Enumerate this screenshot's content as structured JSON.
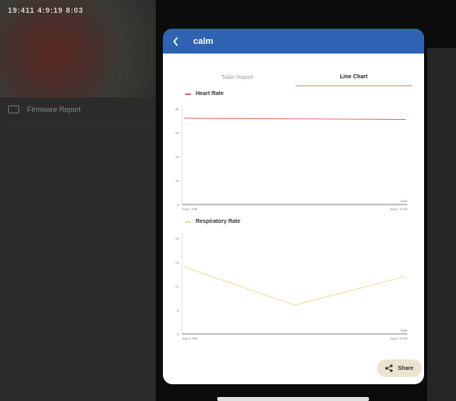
{
  "status_bar": {
    "text": "19:411 4:9:19 8:03"
  },
  "background": {
    "list_item_label": "Firmware Report"
  },
  "modal": {
    "title": "calm",
    "tabs": [
      {
        "label": "Table Report",
        "active": false
      },
      {
        "label": "Line Chart",
        "active": true
      }
    ],
    "share_label": "Share",
    "colors": {
      "header": "#2e63b3",
      "tab_underline": "#f08070",
      "heart_rate": "#f06060",
      "respiratory": "#e8d98a",
      "share_bg": "#ece4cf"
    }
  },
  "chart_data": [
    {
      "type": "line",
      "title": "Heart Rate",
      "x": [
        "Aug 2 9:56",
        "Aug 2 10:05"
      ],
      "series": [
        {
          "name": "Heart Rate",
          "values": [
            72,
            71
          ]
        }
      ],
      "ylim": [
        0,
        80
      ],
      "yticks": [
        "0",
        "20",
        "40",
        "60",
        "80"
      ],
      "x_tick_labels": [
        "Aug 2 9:56",
        "Aug 2 10:05"
      ],
      "xlabel": "Date",
      "grid": false
    },
    {
      "type": "line",
      "title": "Respiratory Rate",
      "x": [
        "Aug 2 9:56",
        "Aug 2 10:00",
        "Aug 2 10:05"
      ],
      "series": [
        {
          "name": "Respiratory Rate",
          "values": [
            14,
            6,
            12
          ]
        }
      ],
      "ylim": [
        0,
        20
      ],
      "yticks": [
        "0",
        "5",
        "10",
        "15",
        "20"
      ],
      "x_tick_labels": [
        "Aug 2 9:56",
        "Aug 2 10:05"
      ],
      "xlabel": "Date",
      "grid": false
    }
  ]
}
